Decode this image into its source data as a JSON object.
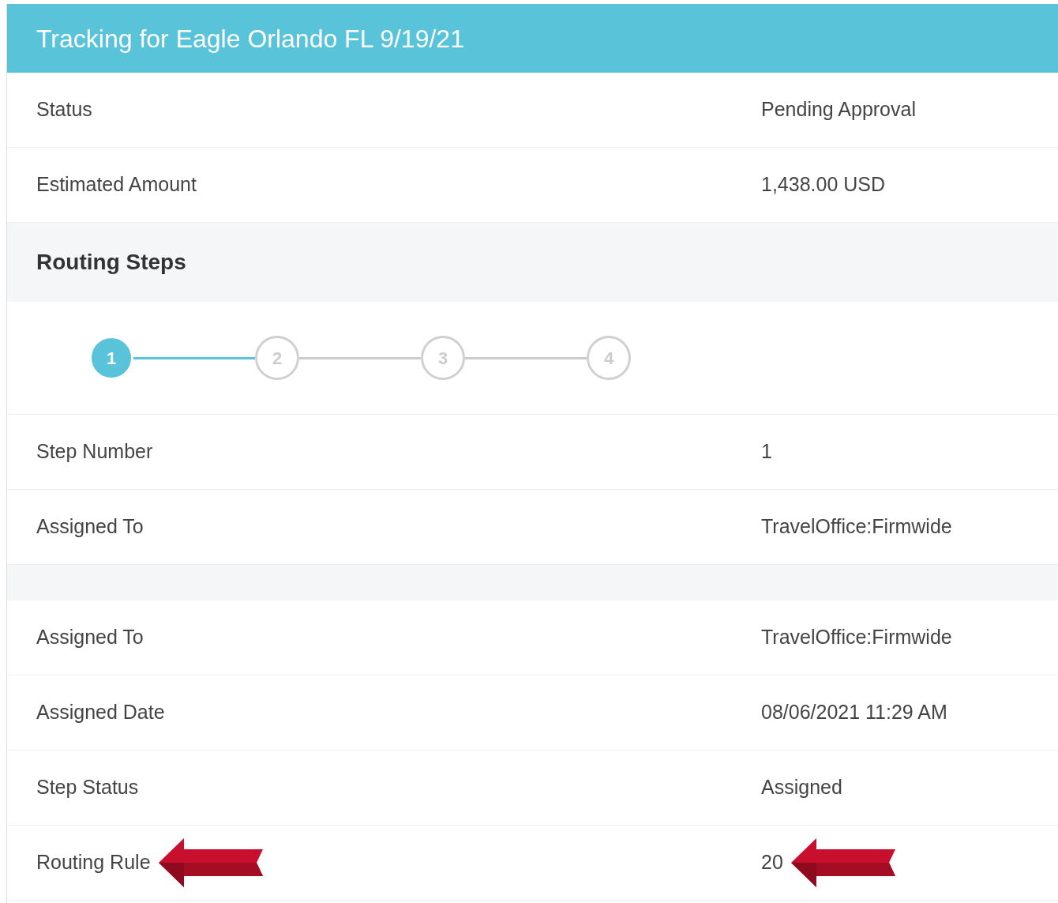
{
  "header": {
    "title": "Tracking for Eagle Orlando FL 9/19/21"
  },
  "summary": [
    {
      "label": "Status",
      "value": "Pending Approval"
    },
    {
      "label": "Estimated Amount",
      "value": "1,438.00 USD"
    }
  ],
  "routing": {
    "title": "Routing Steps",
    "steps": [
      {
        "label": "1",
        "selected": true
      },
      {
        "label": "2",
        "selected": false
      },
      {
        "label": "3",
        "selected": false
      },
      {
        "label": "4",
        "selected": false
      }
    ]
  },
  "step_details": [
    {
      "label": "Step Number",
      "value": "1"
    },
    {
      "label": "Assigned To",
      "value": "TravelOffice:Firmwide"
    }
  ],
  "assignment_details": [
    {
      "label": "Assigned To",
      "value": "TravelOffice:Firmwide",
      "callout": false
    },
    {
      "label": "Assigned Date",
      "value": "08/06/2021 11:29 AM",
      "callout": false
    },
    {
      "label": "Step Status",
      "value": "Assigned",
      "callout": false
    },
    {
      "label": "Routing Rule",
      "value": "20",
      "callout": true
    }
  ]
}
